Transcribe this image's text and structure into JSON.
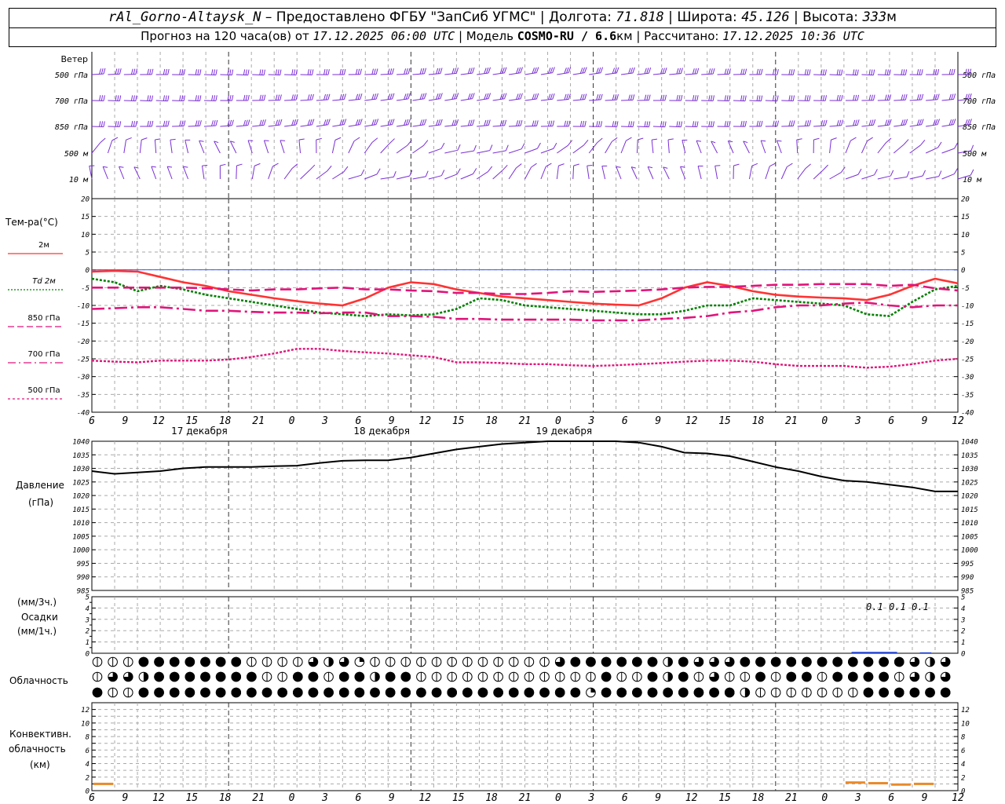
{
  "header": {
    "station": "rAl_Gorno-Altaysk_N",
    "provided_by": " – Предоставлено ФГБУ \"ЗапСиб УГМС\" | ",
    "lon_label": "Долгота: ",
    "lon_value": "71.818",
    "lat_label": " | Широта: ",
    "lat_value": "45.126",
    "alt_label": " | Высота: ",
    "alt_value": "333",
    "alt_unit": "м",
    "forecast_label": "Прогноз на 120 часа(ов) от ",
    "forecast_start": "17.12.2025 06:00 UTC",
    "model_label": " | Модель ",
    "model_name": "COSMO-RU / 6.6",
    "model_unit": "км",
    "calc_label": " | Рассчитано: ",
    "calc_time": "17.12.2025 10:36 UTC"
  },
  "wind": {
    "title": "Ветер",
    "levels": [
      "500 гПа",
      "700 гПа",
      "850 гПа",
      "500 м",
      "10  м"
    ]
  },
  "temp_panel": {
    "title": "Тем-ра(°С)",
    "legend": [
      {
        "label": "2м",
        "color": "#ff3333",
        "style": "solid"
      },
      {
        "label": "Td  2м",
        "color": "#008000",
        "style": "dotted"
      },
      {
        "label": "850 гПа",
        "color": "#e0147a",
        "style": "dash"
      },
      {
        "label": "700 гПа",
        "color": "#e0147a",
        "style": "dashdot"
      },
      {
        "label": "500 гПа",
        "color": "#e0147a",
        "style": "dot"
      }
    ],
    "yticks": [
      "20",
      "15",
      "10",
      "5",
      "0",
      "-5",
      "-10",
      "-15",
      "-20",
      "-25",
      "-30",
      "-35",
      "-40"
    ]
  },
  "time_axis": {
    "hours": [
      "6",
      "9",
      "12",
      "15",
      "18",
      "21",
      "0",
      "3",
      "6",
      "9",
      "12",
      "15",
      "18",
      "21",
      "0",
      "3",
      "6",
      "9",
      "12",
      "15",
      "18",
      "21",
      "0",
      "3",
      "6",
      "9",
      "12"
    ],
    "days": [
      "17 декабря",
      "18 декабря",
      "19 декабря"
    ]
  },
  "pressure_panel": {
    "title": "Давление",
    "unit": "(гПа)",
    "yticks": [
      "1040",
      "1035",
      "1030",
      "1025",
      "1020",
      "1015",
      "1010",
      "1005",
      "1000",
      "995",
      "990",
      "985"
    ]
  },
  "precip_panel": {
    "unit3": "(мм/3ч.)",
    "title": "Осадки",
    "unit1": "(мм/1ч.)",
    "yticks": [
      "5",
      "4",
      "3",
      "2",
      "1",
      "0"
    ],
    "labels": [
      "0.1",
      "0.1",
      "0.1"
    ]
  },
  "cloud_panel": {
    "title": "Облачность"
  },
  "conv_panel": {
    "title1": "Конвективн.",
    "title2": "облачность",
    "unit": "(км)",
    "yticks": [
      "12",
      "10",
      "8",
      "6",
      "4",
      "2",
      "0"
    ]
  },
  "chart_data": [
    {
      "type": "line",
      "title": "Тем-ра(°С)",
      "x_unit": "hours from 17.12.2025 06:00 UTC",
      "x": [
        0,
        3,
        6,
        9,
        12,
        15,
        18,
        21,
        24,
        27,
        30,
        33,
        36,
        39,
        42,
        45,
        48,
        51,
        54,
        57,
        60,
        63,
        66,
        69,
        72,
        75,
        78,
        81,
        84,
        87,
        90,
        93,
        96,
        99,
        102,
        105,
        108,
        111,
        114
      ],
      "ylim": [
        -40,
        20
      ],
      "series": [
        {
          "name": "2м",
          "color": "#ff3333",
          "values": [
            -0.5,
            -0.3,
            -0.5,
            -2,
            -3.5,
            -4.5,
            -6,
            -7,
            -8,
            -8.8,
            -9.5,
            -10,
            -8,
            -5,
            -3.5,
            -4,
            -5.5,
            -6.5,
            -7.5,
            -8,
            -8.5,
            -9,
            -9.5,
            -9.8,
            -10,
            -8,
            -5,
            -3.5,
            -4.5,
            -6,
            -7,
            -7.5,
            -7.8,
            -8,
            -8.5,
            -7,
            -4.5,
            -2.5,
            -3.8
          ]
        },
        {
          "name": "Td  2м",
          "color": "#008000",
          "values": [
            -2.5,
            -3.5,
            -6,
            -4.5,
            -5.5,
            -7,
            -8,
            -9,
            -10,
            -11,
            -12,
            -12.5,
            -13,
            -12.5,
            -12.8,
            -12.5,
            -11,
            -8,
            -8.5,
            -10,
            -10.5,
            -11,
            -11.5,
            -12,
            -12.5,
            -12.5,
            -11.5,
            -10,
            -10,
            -8,
            -8.5,
            -9,
            -9.5,
            -10,
            -12.5,
            -13,
            -9,
            -5.5,
            -4.5
          ]
        },
        {
          "name": "850 гПа",
          "color": "#e0147a",
          "values": [
            -5,
            -5,
            -5,
            -5,
            -5,
            -5.2,
            -5.5,
            -5.8,
            -5.5,
            -5.5,
            -5.2,
            -5,
            -5.5,
            -5.5,
            -5.8,
            -6,
            -6.5,
            -6.5,
            -6.8,
            -6.8,
            -6.5,
            -6,
            -6.2,
            -6,
            -5.8,
            -5.5,
            -5,
            -4.8,
            -4.8,
            -4.5,
            -4.2,
            -4.2,
            -4,
            -4,
            -4,
            -4.5,
            -4.2,
            -5.2,
            -5.8
          ]
        },
        {
          "name": "700 гПа",
          "color": "#e0147a",
          "values": [
            -11,
            -10.8,
            -10.5,
            -10.5,
            -11,
            -11.5,
            -11.5,
            -11.8,
            -12,
            -12,
            -12.2,
            -12,
            -12,
            -13,
            -13,
            -13.2,
            -13.8,
            -13.8,
            -14,
            -14,
            -14,
            -14,
            -14.2,
            -14.2,
            -14.2,
            -13.8,
            -13.5,
            -13,
            -12,
            -11.5,
            -10.5,
            -10,
            -10,
            -9.5,
            -9.2,
            -10,
            -10.5,
            -10,
            -10
          ]
        },
        {
          "name": "500 гПа",
          "color": "#e0147a",
          "values": [
            -25.5,
            -25.8,
            -26,
            -25.5,
            -25.5,
            -25.5,
            -25.2,
            -24.5,
            -23.5,
            -22.2,
            -22.2,
            -22.8,
            -23.2,
            -23.5,
            -24,
            -24.5,
            -26,
            -26,
            -26.2,
            -26.5,
            -26.5,
            -26.8,
            -27,
            -26.8,
            -26.5,
            -26.2,
            -25.8,
            -25.5,
            -25.5,
            -25.8,
            -26.5,
            -27,
            -27,
            -27,
            -27.5,
            -27.2,
            -26.5,
            -25.5,
            -25
          ]
        }
      ]
    },
    {
      "type": "line",
      "title": "Давление",
      "x": [
        0,
        3,
        6,
        9,
        12,
        15,
        18,
        21,
        24,
        27,
        30,
        33,
        36,
        39,
        42,
        45,
        48,
        51,
        54,
        57,
        60,
        63,
        66,
        69,
        72,
        75,
        78,
        81,
        84,
        87,
        90,
        93,
        96,
        99,
        102,
        105,
        108,
        111,
        114
      ],
      "ylim": [
        985,
        1040
      ],
      "series": [
        {
          "color": "#000000",
          "values": [
            1029,
            1028,
            1028.5,
            1029,
            1030,
            1030.5,
            1030.5,
            1030.5,
            1030.8,
            1031,
            1032,
            1032.8,
            1033,
            1033,
            1034,
            1035.5,
            1037,
            1038,
            1039,
            1039.5,
            1040,
            1040,
            1040,
            1040,
            1039.5,
            1038,
            1035.8,
            1035.5,
            1034.5,
            1032.5,
            1030.5,
            1029,
            1027,
            1025.5,
            1025,
            1024,
            1023,
            1021.5,
            1021.5
          ]
        }
      ]
    },
    {
      "type": "bar",
      "title": "Осадки",
      "ylim": [
        0,
        5
      ],
      "x": [
        102,
        105,
        108
      ],
      "values": [
        0.1,
        0.1,
        0.1
      ],
      "color": "#1f3fcf"
    },
    {
      "type": "bar",
      "title": "Конвективн. облачность",
      "ylim": [
        0,
        13
      ],
      "segments": [
        {
          "x0": 0,
          "x1": 3,
          "value": 1.0,
          "color": "#e98a2a"
        },
        {
          "x0": 99,
          "x1": 102,
          "value": 1.2,
          "color": "#e98a2a"
        },
        {
          "x0": 102,
          "x1": 105,
          "value": 1.1,
          "color": "#e98a2a"
        },
        {
          "x0": 105,
          "x1": 108,
          "value": 0.9,
          "color": "#e98a2a"
        },
        {
          "x0": 108,
          "x1": 111,
          "value": 1.0,
          "color": "#e98a2a"
        }
      ]
    }
  ],
  "clouds": {
    "rows": [
      "FFF0000000FFFF2E2GFFFFFFFFFFFF2000000E0222000000000002E2",
      "F22E0000000FF00F00E00FFFFFFFFFFFF0FF0E0F2FF0F00F0000F2E2",
      "0FF00000000000000000000000000000G000000000EFFFFFFF00000"
    ]
  }
}
